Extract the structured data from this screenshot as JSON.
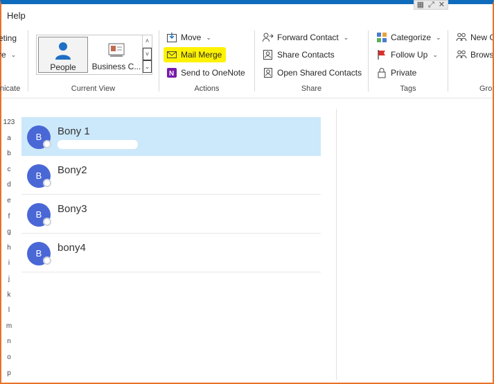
{
  "menu": {
    "help": "Help"
  },
  "window": {
    "icons": [
      "grid-icon",
      "restore-icon",
      "close-icon"
    ],
    "glyphs": [
      "▦",
      "⤢",
      "✕"
    ]
  },
  "ribbon": {
    "left_partial": {
      "items": [
        "eting",
        "re"
      ],
      "label": "nicate"
    },
    "current_view": {
      "label": "Current View",
      "views": [
        {
          "label": "People",
          "selected": true
        },
        {
          "label": "Business C...",
          "selected": false
        }
      ]
    },
    "actions": {
      "label": "Actions",
      "move": "Move",
      "mail_merge": "Mail Merge",
      "send_onenote": "Send to OneNote"
    },
    "share": {
      "label": "Share",
      "forward_contact": "Forward Contact",
      "share_contacts": "Share Contacts",
      "open_shared": "Open Shared Contacts"
    },
    "tags": {
      "label": "Tags",
      "categorize": "Categorize",
      "follow_up": "Follow Up",
      "private": "Private"
    },
    "groups_partial": {
      "label": "Grou",
      "new_group": "New G",
      "browse": "Browse"
    }
  },
  "alphabet": [
    "123",
    "a",
    "b",
    "c",
    "d",
    "e",
    "f",
    "g",
    "h",
    "i",
    "j",
    "k",
    "l",
    "m",
    "n",
    "o",
    "p"
  ],
  "contacts": [
    {
      "initial": "B",
      "name": "Bony 1",
      "selected": true
    },
    {
      "initial": "B",
      "name": "Bony2",
      "selected": false
    },
    {
      "initial": "B",
      "name": "Bony3",
      "selected": false
    },
    {
      "initial": "B",
      "name": "bony4",
      "selected": false
    }
  ],
  "colors": {
    "accent": "#0f6cbd",
    "avatar": "#4a67d6",
    "selected_row": "#cce8fb",
    "highlight": "#fff200",
    "frame": "#e8722a"
  }
}
